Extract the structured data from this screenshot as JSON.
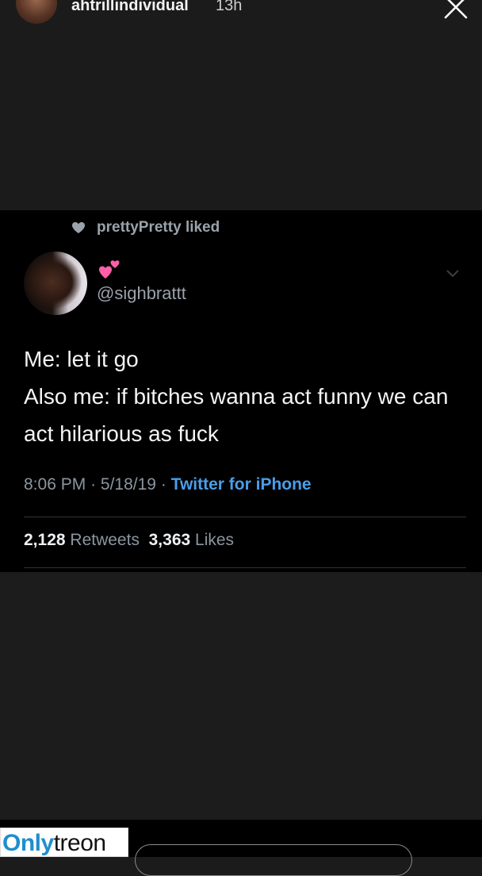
{
  "story": {
    "username": "ahtrillindividual",
    "time_ago": "13h"
  },
  "tweet": {
    "liked_by_name": "prettyPretty",
    "liked_label": "liked",
    "handle": "@sighbrattt",
    "lines": [
      "Me: let it go",
      "Also me: if bitches wanna act funny we can act hilarious as fuck"
    ],
    "time": "8:06 PM",
    "date": "5/18/19",
    "sep": "·",
    "source": "Twitter for iPhone",
    "retweets": "2,128",
    "retweets_label": "Retweets",
    "likes": "3,363",
    "likes_label": "Likes"
  },
  "watermark": {
    "part1": "Only",
    "part2": "treon"
  },
  "colors": {
    "accent_blue": "#4a9ee8",
    "muted": "#8b96a0"
  },
  "icons": [
    "close-icon",
    "heart-icon",
    "two-hearts-emoji-icon",
    "chevron-down-icon"
  ]
}
